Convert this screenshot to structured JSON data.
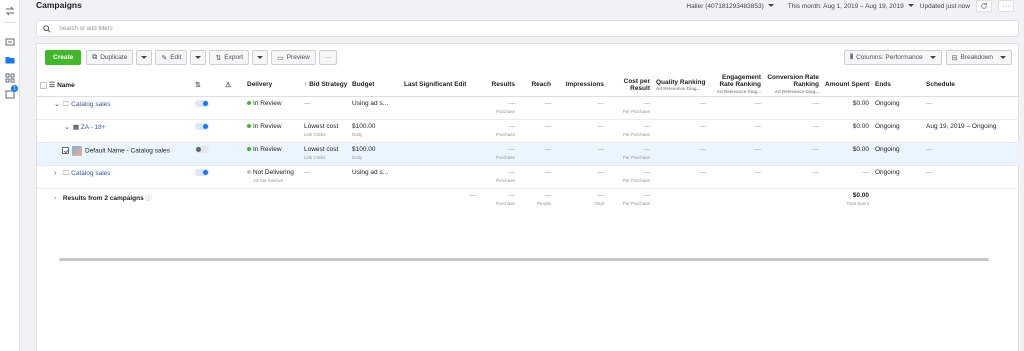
{
  "header": {
    "title": "Campaigns",
    "account": "Haller (407181293483853)",
    "date_range": "This month: Aug 1, 2019 – Aug 19, 2019",
    "updated": "Updated just now",
    "more": "···"
  },
  "rail": {
    "badge": "1"
  },
  "search": {
    "placeholder": "Search or add filters"
  },
  "toolbar": {
    "create": "Create",
    "duplicate": "Duplicate",
    "edit": "Edit",
    "export": "Export",
    "preview": "Preview",
    "more": "···",
    "columns": "Columns: Performance",
    "breakdown": "Breakdown"
  },
  "table": {
    "headers": {
      "name": "Name",
      "delivery": "Delivery",
      "bid_strategy": "Bid Strategy",
      "budget": "Budget",
      "last_edit": "Last Significant Edit",
      "results": "Results",
      "reach": "Reach",
      "impressions": "Impressions",
      "cost_per_result": "Cost per Result",
      "quality": "Quality Ranking",
      "quality_sub": "Ad Relevance Diag...",
      "engagement": "Engagement Rate Ranking",
      "engagement_sub": "Ad Relevance Diag...",
      "conversion": "Conversion Rate Ranking",
      "conversion_sub": "Ad Relevance Diag...",
      "amount_spent": "Amount Spent",
      "ends": "Ends",
      "schedule": "Schedule"
    },
    "rows": [
      {
        "name": "Catalog sales",
        "delivery": "In Review",
        "delivery_sub": "",
        "bid": "—",
        "bid_sub": "",
        "budget": "Using ad s...",
        "budget_sub": "",
        "results": "—",
        "results_sub": "Purchase",
        "reach": "—",
        "impressions": "—",
        "cost": "—",
        "cost_sub": "Per Purchase",
        "quality": "—",
        "engagement": "—",
        "conversion": "—",
        "spent": "$0.00",
        "ends": "Ongoing",
        "schedule": "—"
      },
      {
        "name": "ZA - 18+",
        "delivery": "In Review",
        "delivery_sub": "",
        "bid": "Lowest cost",
        "bid_sub": "Link Clicks",
        "budget": "$100.00",
        "budget_sub": "Daily",
        "results": "—",
        "results_sub": "Purchase",
        "reach": "—",
        "impressions": "—",
        "cost": "—",
        "cost_sub": "Per Purchase",
        "quality": "—",
        "engagement": "—",
        "conversion": "—",
        "spent": "$0.00",
        "ends": "Ongoing",
        "schedule": "Aug 19, 2019 – Ongoing"
      },
      {
        "name": "Default Name - Catalog sales",
        "delivery": "In Review",
        "delivery_sub": "",
        "bid": "Lowest cost",
        "bid_sub": "Link Clicks",
        "budget": "$100.00",
        "budget_sub": "Daily",
        "results": "—",
        "results_sub": "Purchase",
        "reach": "—",
        "impressions": "—",
        "cost": "—",
        "cost_sub": "Per Purchase",
        "quality": "—",
        "engagement": "—",
        "conversion": "—",
        "spent": "$0.00",
        "ends": "Ongoing",
        "schedule": "—"
      },
      {
        "name": "Catalog sales",
        "delivery": "Not Delivering",
        "delivery_sub": "Ad Set Inactive",
        "bid": "—",
        "bid_sub": "",
        "budget": "Using ad s...",
        "budget_sub": "",
        "results": "—",
        "results_sub": "Purchase",
        "reach": "—",
        "impressions": "—",
        "cost": "—",
        "cost_sub": "Per Purchase",
        "quality": "—",
        "engagement": "—",
        "conversion": "—",
        "spent": "—",
        "ends": "Ongoing",
        "schedule": "—"
      }
    ],
    "summary": {
      "label": "Results from 2 campaigns",
      "last_edit": "—",
      "results": "—",
      "results_sub": "Purchase",
      "reach": "—",
      "reach_sub": "People",
      "impressions": "—",
      "impressions_sub": "Total",
      "cost": "—",
      "cost_sub": "Per Purchase",
      "spent": "$0.00",
      "spent_sub": "Total Spent"
    }
  },
  "colors": {
    "accent": "#1877f2",
    "create": "#42b72a",
    "link": "#365899"
  }
}
